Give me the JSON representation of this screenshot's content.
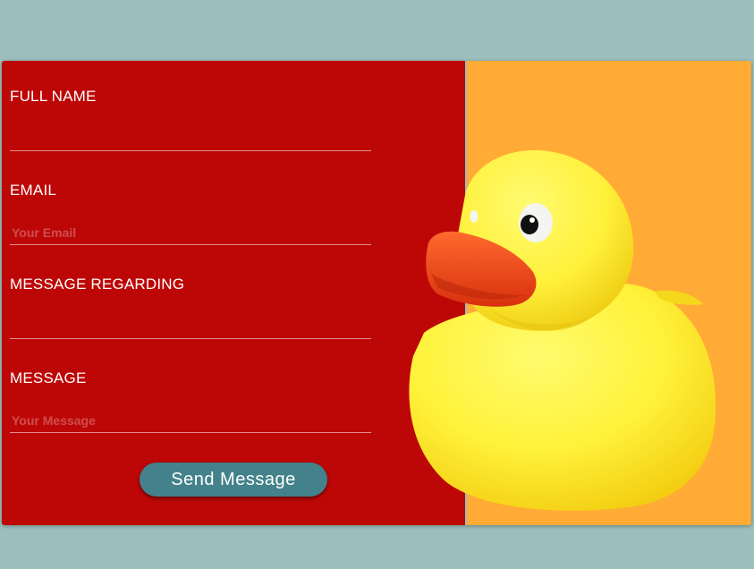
{
  "form": {
    "full_name": {
      "label": "FULL NAME",
      "value": "",
      "placeholder": ""
    },
    "email": {
      "label": "EMAIL",
      "value": "",
      "placeholder": "Your Email"
    },
    "message_regarding": {
      "label": "MESSAGE REGARDING",
      "value": "",
      "placeholder": ""
    },
    "message": {
      "label": "MESSAGE",
      "value": "",
      "placeholder": "Your Message"
    },
    "submit_label": "Send Message"
  },
  "image": {
    "icon": "rubber-duck-illustration"
  },
  "colors": {
    "page_background": "#9cbfbd",
    "form_background": "#bd0707",
    "image_background": "#ffab36",
    "button_background": "#43828a",
    "duck_body": "#fff23a",
    "duck_beak": "#f04a1a"
  }
}
